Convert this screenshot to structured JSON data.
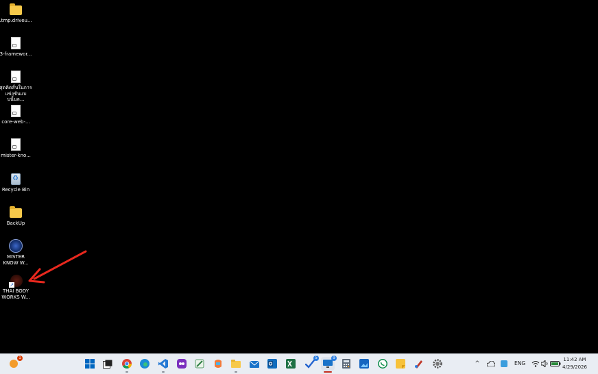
{
  "desktop": {
    "icons": [
      {
        "label": ".tmp.driveu...",
        "icon": "folder-icon"
      },
      {
        "label": "3-framewor...",
        "icon": "document-icon"
      },
      {
        "label": "สุดคิดสั่นในการ แข่งขันแบบนั้นล...",
        "icon": "document-icon"
      },
      {
        "label": "core-web-...",
        "icon": "document-icon"
      },
      {
        "label": "mister-kno...",
        "icon": "document-icon"
      },
      {
        "label": "Recycle Bin",
        "icon": "recycle-bin-icon"
      },
      {
        "label": "BackUp",
        "icon": "folder-icon"
      },
      {
        "label": "MISTER KNOW W...",
        "icon": "app-logo-icon"
      },
      {
        "label": "THAI BODY WORKS W...",
        "icon": "shortcut-icon"
      }
    ]
  },
  "taskbar": {
    "weather_badge": "1",
    "outlook_badge": "5",
    "teams_badge": "9",
    "language": "ENG",
    "time": "11:42 AM",
    "date": "4/29/2026"
  },
  "annotation": {
    "arrow_color": "#e8281e"
  }
}
